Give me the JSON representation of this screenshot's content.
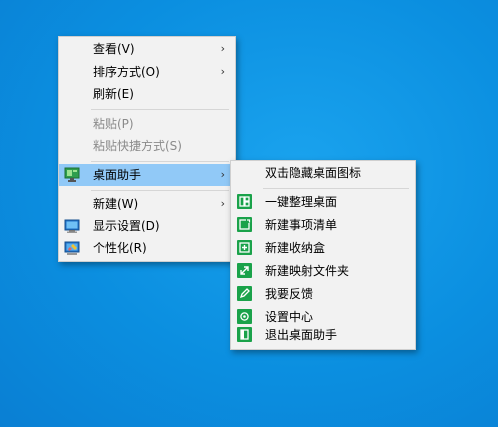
{
  "context_menu": {
    "items": [
      {
        "label": "查看(V)",
        "has_submenu": true,
        "enabled": true
      },
      {
        "label": "排序方式(O)",
        "has_submenu": true,
        "enabled": true
      },
      {
        "label": "刷新(E)",
        "has_submenu": false,
        "enabled": true
      },
      {
        "label": "粘贴(P)",
        "has_submenu": false,
        "enabled": false
      },
      {
        "label": "粘贴快捷方式(S)",
        "has_submenu": false,
        "enabled": false
      },
      {
        "label": "桌面助手",
        "has_submenu": true,
        "enabled": true,
        "highlighted": true,
        "icon": "desktop-assistant-icon"
      },
      {
        "label": "新建(W)",
        "has_submenu": true,
        "enabled": true
      },
      {
        "label": "显示设置(D)",
        "has_submenu": false,
        "enabled": true,
        "icon": "display-icon"
      },
      {
        "label": "个性化(R)",
        "has_submenu": false,
        "enabled": true,
        "icon": "personalize-icon"
      }
    ],
    "arrow_glyph": "›"
  },
  "submenu": {
    "header": "双击隐藏桌面图标",
    "items": [
      {
        "label": "一键整理桌面",
        "icon": "organize-icon"
      },
      {
        "label": "新建事项清单",
        "icon": "todo-list-icon"
      },
      {
        "label": "新建收纳盒",
        "icon": "storage-box-icon"
      },
      {
        "label": "新建映射文件夹",
        "icon": "mapped-folder-icon"
      },
      {
        "label": "我要反馈",
        "icon": "feedback-icon"
      },
      {
        "label": "设置中心",
        "icon": "settings-icon"
      },
      {
        "label": "退出桌面助手",
        "icon": "exit-icon"
      }
    ]
  },
  "colors": {
    "desktop": "#0b8fe0",
    "menu_bg": "#f2f2f2",
    "highlight": "#91c9f7",
    "icon_green": "#1aa24a"
  }
}
